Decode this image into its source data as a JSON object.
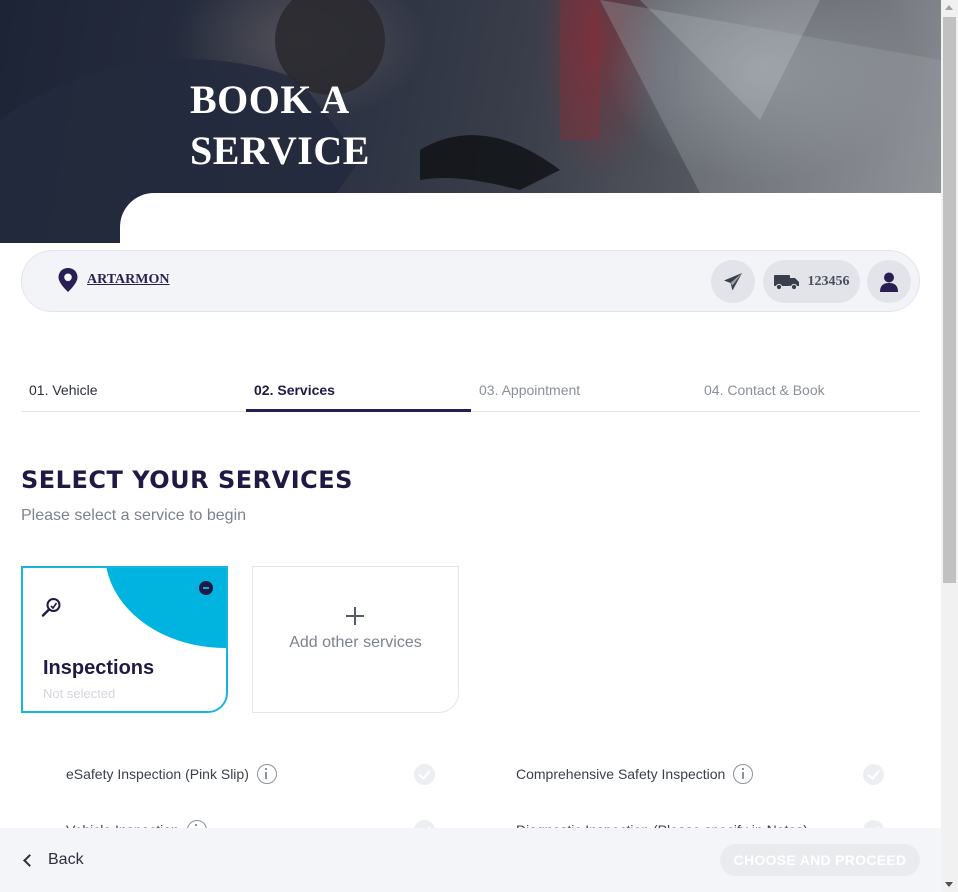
{
  "hero": {
    "title_line1": "BOOK A",
    "title_line2": "SERVICE"
  },
  "location_bar": {
    "pin_icon": "map-pin-icon",
    "location": "ARTARMON",
    "send_icon": "paper-plane-icon",
    "vehicle_icon": "truck-icon",
    "rego": "123456",
    "user_icon": "user-icon"
  },
  "steps": [
    {
      "label": "01. Vehicle",
      "state": "done"
    },
    {
      "label": "02. Services",
      "state": "active"
    },
    {
      "label": "03. Appointment",
      "state": "upcoming"
    },
    {
      "label": "04. Contact & Book",
      "state": "upcoming"
    }
  ],
  "main": {
    "heading": "SELECT YOUR SERVICES",
    "subheading": "Please select a service to begin"
  },
  "cards": {
    "inspections": {
      "icon": "magnifier-icon",
      "title": "Inspections",
      "status": "Not selected"
    },
    "add_other": {
      "label": "Add other services"
    }
  },
  "options": [
    {
      "label": "eSafety Inspection (Pink Slip)"
    },
    {
      "label": "Comprehensive Safety Inspection"
    },
    {
      "label": "Vehicle Inspection"
    },
    {
      "label": "Diagnostic Inspection (Please specify in Notes)"
    }
  ],
  "footer": {
    "back_label": "Back",
    "proceed_label": "CHOOSE AND PROCEED"
  },
  "colors": {
    "brand_navy": "#1f1a45",
    "accent_cyan": "#00b4df"
  }
}
